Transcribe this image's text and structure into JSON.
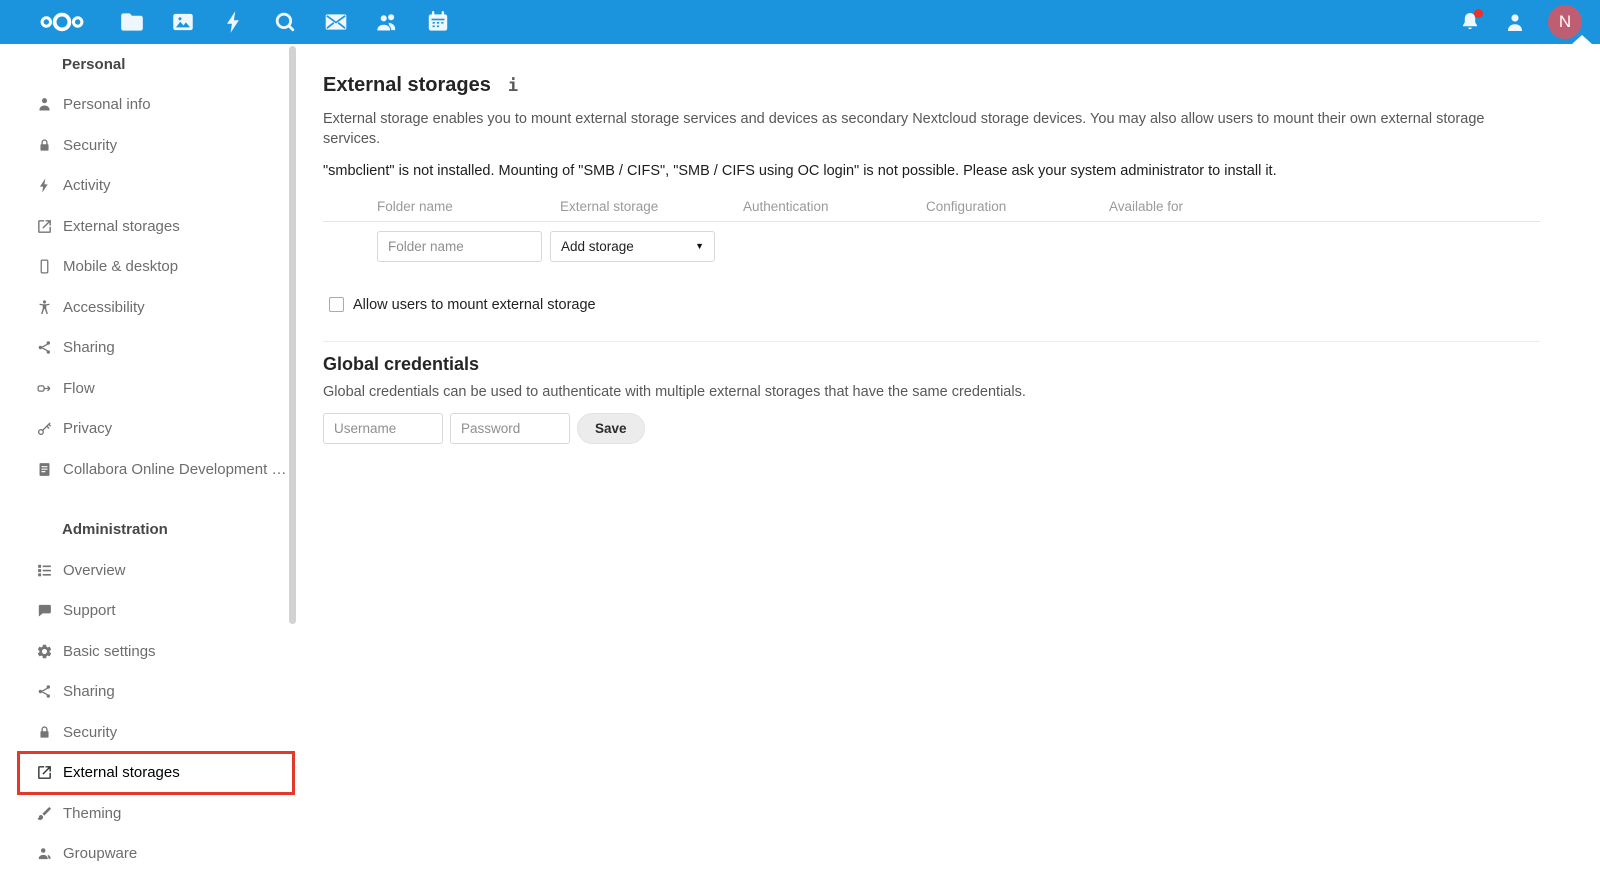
{
  "header": {
    "app_icons": [
      {
        "app": "files",
        "icon": "folder-icon",
        "glyph": "folder"
      },
      {
        "app": "photos",
        "icon": "photos-icon",
        "glyph": "photos"
      },
      {
        "app": "activity",
        "icon": "lightning-icon",
        "glyph": "lightning"
      },
      {
        "app": "search",
        "icon": "magnifier-icon",
        "glyph": "magnifier"
      },
      {
        "app": "mail",
        "icon": "mail-icon",
        "glyph": "mail"
      },
      {
        "app": "contacts",
        "icon": "contacts-icon",
        "glyph": "contacts"
      },
      {
        "app": "calendar",
        "icon": "calendar-icon",
        "glyph": "calendar"
      }
    ],
    "right": {
      "notifications_icon": "bell-icon",
      "has_notification_dot": true,
      "contacts_menu_icon": "person-icon",
      "avatar_initial": "N",
      "avatar_color": "#bf5e72"
    }
  },
  "sidebar": {
    "sections": [
      {
        "label": "Personal",
        "items": [
          {
            "label": "Personal info",
            "glyph": "user"
          },
          {
            "label": "Security",
            "glyph": "lock"
          },
          {
            "label": "Activity",
            "glyph": "lightning"
          },
          {
            "label": "External storages",
            "glyph": "external"
          },
          {
            "label": "Mobile & desktop",
            "glyph": "mobile"
          },
          {
            "label": "Accessibility",
            "glyph": "accessibility"
          },
          {
            "label": "Sharing",
            "glyph": "share"
          },
          {
            "label": "Flow",
            "glyph": "flow"
          },
          {
            "label": "Privacy",
            "glyph": "key"
          },
          {
            "label": "Collabora Online Development Edit...",
            "glyph": "document"
          }
        ]
      },
      {
        "label": "Administration",
        "items": [
          {
            "label": "Overview",
            "glyph": "overview"
          },
          {
            "label": "Support",
            "glyph": "chat"
          },
          {
            "label": "Basic settings",
            "glyph": "gear"
          },
          {
            "label": "Sharing",
            "glyph": "share"
          },
          {
            "label": "Security",
            "glyph": "lock"
          },
          {
            "label": "External storages",
            "glyph": "external",
            "active": true,
            "annotated": true
          },
          {
            "label": "Theming",
            "glyph": "brush"
          },
          {
            "label": "Groupware",
            "glyph": "group"
          }
        ]
      }
    ]
  },
  "main": {
    "title": "External storages",
    "info_icon": "i",
    "description": "External storage enables you to mount external storage services and devices as secondary Nextcloud storage devices. You may also allow users to mount their own external storage services.",
    "warning": "\"smbclient\" is not installed. Mounting of \"SMB / CIFS\", \"SMB / CIFS using OC login\" is not possible. Please ask your system administrator to install it.",
    "table": {
      "headers": [
        "Folder name",
        "External storage",
        "Authentication",
        "Configuration",
        "Available for"
      ],
      "folder_name_placeholder": "Folder name",
      "add_storage_label": "Add storage"
    },
    "allow_users_label": "Allow users to mount external storage",
    "allow_users_checked": false,
    "global_credentials": {
      "title": "Global credentials",
      "description": "Global credentials can be used to authenticate with multiple external storages that have the same credentials.",
      "username_placeholder": "Username",
      "password_placeholder": "Password",
      "save_label": "Save"
    }
  },
  "colors": {
    "header_bg": "#1c94dd",
    "annotation_red": "#e2392b",
    "avatar_bg": "#bf5e72",
    "notification_dot": "#e9322d"
  }
}
